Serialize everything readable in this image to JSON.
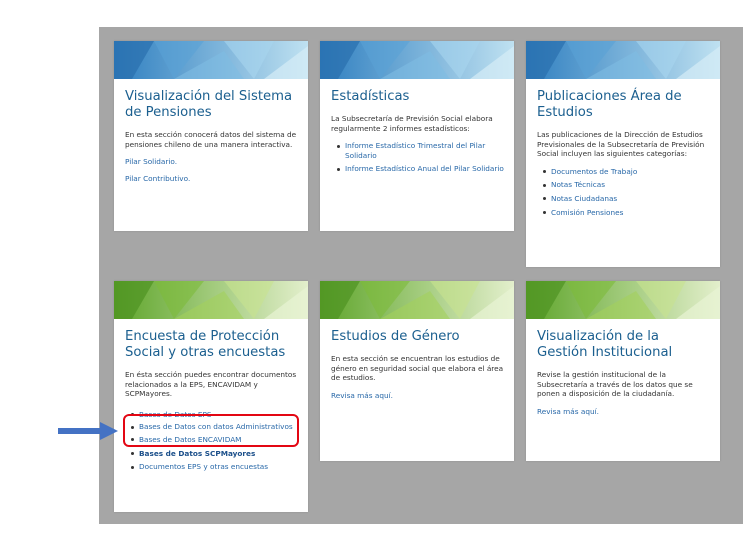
{
  "colors": {
    "panel": "#a6a6a6",
    "title": "#1b5f8f",
    "link": "#2868a8",
    "banner_blue": "#4a90c8",
    "banner_green": "#8cc63f",
    "highlight": "#e30613",
    "arrow": "#4472c4"
  },
  "annotation": {
    "arrow_icon": "arrow-right-icon"
  },
  "cards": {
    "pensiones": {
      "title": "Visualización del Sistema de Pensiones",
      "desc": "En esta sección conocerá datos del sistema de pensiones chileno de una manera interactiva.",
      "link1": "Pilar Solidario.",
      "link2": "Pilar Contributivo."
    },
    "estadisticas": {
      "title": "Estadísticas",
      "desc": "La Subsecretaría de Previsión Social elabora regularmente 2 informes estadísticos:",
      "items": [
        "Informe Estadístico Trimestral del Pilar Solidario",
        "Informe Estadístico Anual del Pilar Solidario"
      ]
    },
    "publicaciones": {
      "title": "Publicaciones Área de Estudios",
      "desc": "Las publicaciones de la Dirección de Estudios Previsionales de la Subsecretaría de Previsión Social incluyen las siguientes categorías:",
      "items": [
        "Documentos de Trabajo",
        "Notas Técnicas",
        "Notas Ciudadanas",
        "Comisión Pensiones"
      ]
    },
    "encuesta": {
      "title": "Encuesta de Protección Social y otras encuestas",
      "desc": "En ésta sección puedes encontrar documentos relacionados a la EPS, ENCAVIDAM y SCPMayores.",
      "items": [
        "Bases de Datos EPS",
        "Bases de Datos con datos Administrativos",
        "Bases de Datos ENCAVIDAM",
        "Bases de Datos SCPMayores",
        "Documentos EPS y otras encuestas"
      ]
    },
    "genero": {
      "title": "Estudios de Género",
      "desc": "En esta sección se encuentran los estudios de género en seguridad social que elabora el área de estudios.",
      "link": "Revisa más aquí."
    },
    "gestion": {
      "title": "Visualización de la Gestión Institucional",
      "desc": "Revise la gestión institucional de la Subsecretaría a través de los datos que se ponen a disposición de la ciudadanía.",
      "link": "Revisa más aquí."
    }
  }
}
